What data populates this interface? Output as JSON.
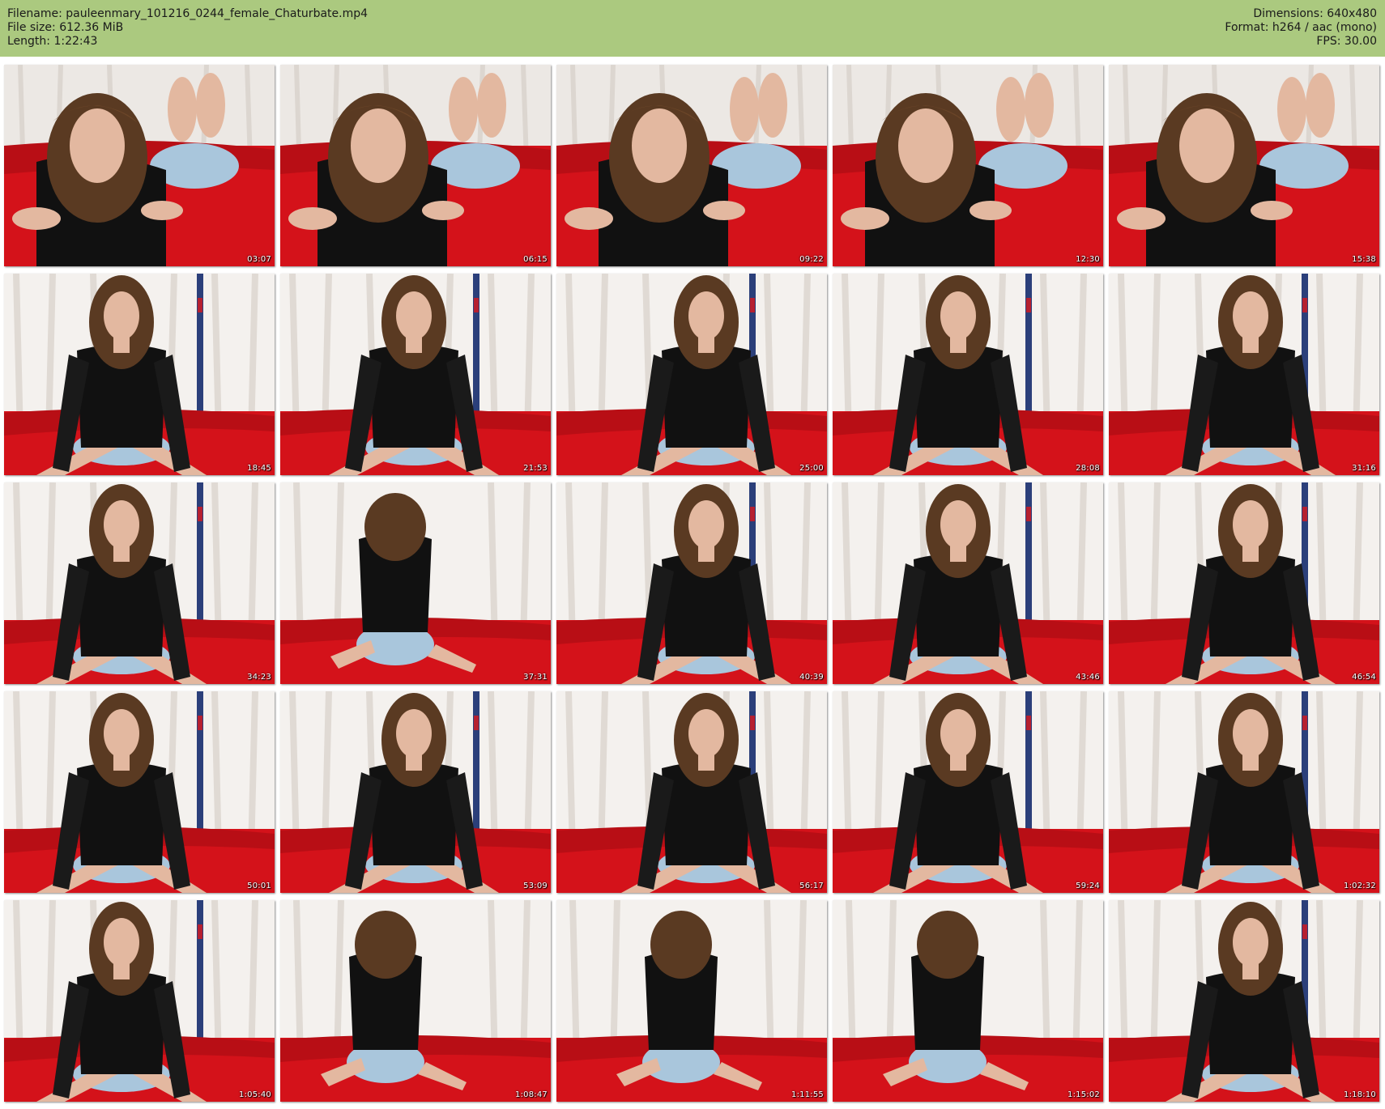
{
  "header": {
    "filename": "Filename: pauleenmary_101216_0244_female_Chaturbate.mp4",
    "filesize": "File size: 612.36 MiB",
    "length": "Length: 1:22:43",
    "dimensions": "Dimensions: 640x480",
    "format": "Format: h264 / aac (mono)",
    "fps": "FPS: 30.00"
  },
  "colors": {
    "header_bg": "#abc97f",
    "bed_red": "#d4121a",
    "curtain_white": "#f4f1ee",
    "top_black": "#111111",
    "shorts_blue": "#a9c6dc",
    "hair_brown": "#5a3a22",
    "skin": "#e3b8a0"
  },
  "thumbnails": [
    {
      "timestamp": "03:07",
      "scene": "lying"
    },
    {
      "timestamp": "06:15",
      "scene": "lying"
    },
    {
      "timestamp": "09:22",
      "scene": "lying"
    },
    {
      "timestamp": "12:30",
      "scene": "lying"
    },
    {
      "timestamp": "15:38",
      "scene": "lying"
    },
    {
      "timestamp": "18:45",
      "scene": "sitting"
    },
    {
      "timestamp": "21:53",
      "scene": "sitting"
    },
    {
      "timestamp": "25:00",
      "scene": "sitting"
    },
    {
      "timestamp": "28:08",
      "scene": "sitting"
    },
    {
      "timestamp": "31:16",
      "scene": "sitting"
    },
    {
      "timestamp": "34:23",
      "scene": "sitting"
    },
    {
      "timestamp": "37:31",
      "scene": "back"
    },
    {
      "timestamp": "40:39",
      "scene": "sitting"
    },
    {
      "timestamp": "43:46",
      "scene": "sitting"
    },
    {
      "timestamp": "46:54",
      "scene": "sitting"
    },
    {
      "timestamp": "50:01",
      "scene": "sitting"
    },
    {
      "timestamp": "53:09",
      "scene": "sitting"
    },
    {
      "timestamp": "56:17",
      "scene": "sitting"
    },
    {
      "timestamp": "59:24",
      "scene": "sitting"
    },
    {
      "timestamp": "1:02:32",
      "scene": "sitting"
    },
    {
      "timestamp": "1:05:40",
      "scene": "sitting"
    },
    {
      "timestamp": "1:08:47",
      "scene": "back"
    },
    {
      "timestamp": "1:11:55",
      "scene": "back"
    },
    {
      "timestamp": "1:15:02",
      "scene": "back"
    },
    {
      "timestamp": "1:18:10",
      "scene": "sitting"
    }
  ]
}
